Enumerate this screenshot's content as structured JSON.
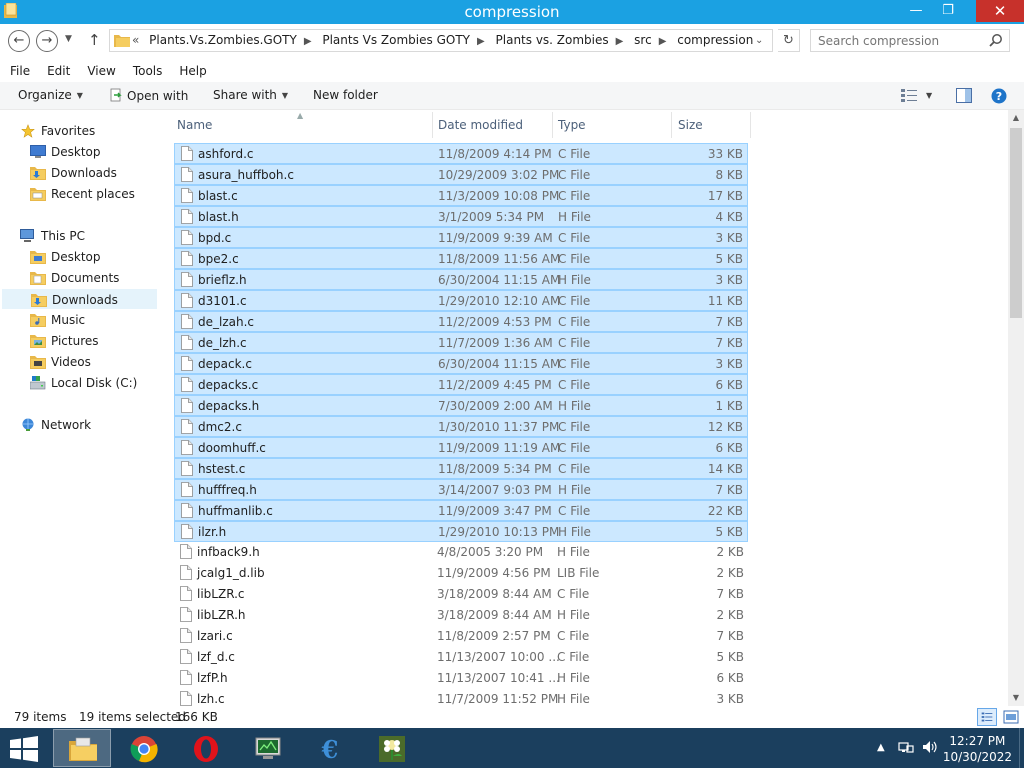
{
  "window": {
    "title": "compression",
    "accent_color": "#1ba1e2"
  },
  "address": {
    "overflow": "«",
    "crumbs": [
      "Plants.Vs.Zombies.GOTY",
      "Plants Vs Zombies GOTY",
      "Plants vs. Zombies",
      "src",
      "compression"
    ],
    "search_placeholder": "Search compression"
  },
  "menu": [
    "File",
    "Edit",
    "View",
    "Tools",
    "Help"
  ],
  "commands": {
    "organize": "Organize",
    "open_with": "Open with",
    "share_with": "Share with",
    "new_folder": "New folder"
  },
  "nav": {
    "favorites": "Favorites",
    "fav_items": [
      "Desktop",
      "Downloads",
      "Recent places"
    ],
    "this_pc": "This PC",
    "pc_items": [
      "Desktop",
      "Documents",
      "Downloads",
      "Music",
      "Pictures",
      "Videos",
      "Local Disk (C:)"
    ],
    "network": "Network",
    "selected": "Downloads"
  },
  "columns": {
    "name": "Name",
    "date": "Date modified",
    "type": "Type",
    "size": "Size"
  },
  "files": [
    {
      "name": "ashford.c",
      "date": "11/8/2009 4:14 PM",
      "type": "C File",
      "size": "33 KB",
      "selected": true
    },
    {
      "name": "asura_huffboh.c",
      "date": "10/29/2009 3:02 PM",
      "type": "C File",
      "size": "8 KB",
      "selected": true
    },
    {
      "name": "blast.c",
      "date": "11/3/2009 10:08 PM",
      "type": "C File",
      "size": "17 KB",
      "selected": true
    },
    {
      "name": "blast.h",
      "date": "3/1/2009 5:34 PM",
      "type": "H File",
      "size": "4 KB",
      "selected": true
    },
    {
      "name": "bpd.c",
      "date": "11/9/2009 9:39 AM",
      "type": "C File",
      "size": "3 KB",
      "selected": true
    },
    {
      "name": "bpe2.c",
      "date": "11/8/2009 11:56 AM",
      "type": "C File",
      "size": "5 KB",
      "selected": true
    },
    {
      "name": "brieflz.h",
      "date": "6/30/2004 11:15 AM",
      "type": "H File",
      "size": "3 KB",
      "selected": true
    },
    {
      "name": "d3101.c",
      "date": "1/29/2010 12:10 AM",
      "type": "C File",
      "size": "11 KB",
      "selected": true
    },
    {
      "name": "de_lzah.c",
      "date": "11/2/2009 4:53 PM",
      "type": "C File",
      "size": "7 KB",
      "selected": true
    },
    {
      "name": "de_lzh.c",
      "date": "11/7/2009 1:36 AM",
      "type": "C File",
      "size": "7 KB",
      "selected": true
    },
    {
      "name": "depack.c",
      "date": "6/30/2004 11:15 AM",
      "type": "C File",
      "size": "3 KB",
      "selected": true
    },
    {
      "name": "depacks.c",
      "date": "11/2/2009 4:45 PM",
      "type": "C File",
      "size": "6 KB",
      "selected": true
    },
    {
      "name": "depacks.h",
      "date": "7/30/2009 2:00 AM",
      "type": "H File",
      "size": "1 KB",
      "selected": true
    },
    {
      "name": "dmc2.c",
      "date": "1/30/2010 11:37 PM",
      "type": "C File",
      "size": "12 KB",
      "selected": true
    },
    {
      "name": "doomhuff.c",
      "date": "11/9/2009 11:19 AM",
      "type": "C File",
      "size": "6 KB",
      "selected": true
    },
    {
      "name": "hstest.c",
      "date": "11/8/2009 5:34 PM",
      "type": "C File",
      "size": "14 KB",
      "selected": true
    },
    {
      "name": "hufffreq.h",
      "date": "3/14/2007 9:03 PM",
      "type": "H File",
      "size": "7 KB",
      "selected": true
    },
    {
      "name": "huffmanlib.c",
      "date": "11/9/2009 3:47 PM",
      "type": "C File",
      "size": "22 KB",
      "selected": true
    },
    {
      "name": "ilzr.h",
      "date": "1/29/2010 10:13 PM",
      "type": "H File",
      "size": "5 KB",
      "selected": true
    },
    {
      "name": "infback9.h",
      "date": "4/8/2005 3:20 PM",
      "type": "H File",
      "size": "2 KB",
      "selected": false
    },
    {
      "name": "jcalg1_d.lib",
      "date": "11/9/2009 4:56 PM",
      "type": "LIB File",
      "size": "2 KB",
      "selected": false
    },
    {
      "name": "libLZR.c",
      "date": "3/18/2009 8:44 AM",
      "type": "C File",
      "size": "7 KB",
      "selected": false
    },
    {
      "name": "libLZR.h",
      "date": "3/18/2009 8:44 AM",
      "type": "H File",
      "size": "2 KB",
      "selected": false
    },
    {
      "name": "lzari.c",
      "date": "11/8/2009 2:57 PM",
      "type": "C File",
      "size": "7 KB",
      "selected": false
    },
    {
      "name": "lzf_d.c",
      "date": "11/13/2007 10:00 ...",
      "type": "C File",
      "size": "5 KB",
      "selected": false
    },
    {
      "name": "lzfP.h",
      "date": "11/13/2007 10:41 ...",
      "type": "H File",
      "size": "6 KB",
      "selected": false
    },
    {
      "name": "lzh.c",
      "date": "11/7/2009 11:52 PM",
      "type": "H File",
      "size": "3 KB",
      "selected": false
    }
  ],
  "status": {
    "items": "79 items",
    "selected": "19 items selected",
    "size": "166 KB"
  },
  "taskbar": {
    "time": "12:27 PM",
    "date": "10/30/2022",
    "bg_color": "#1b3f5e"
  }
}
